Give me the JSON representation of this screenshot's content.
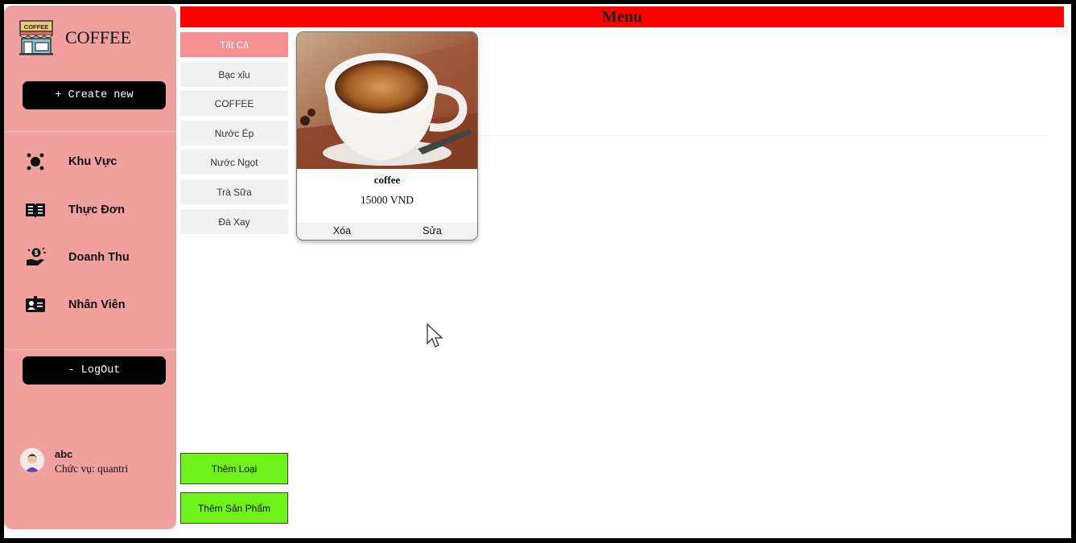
{
  "brand": {
    "title": "COFFEE",
    "logo_text": "COFFEE",
    "logo_icon": "coffee-shop-icon"
  },
  "sidebar": {
    "create_label": "+ Create new",
    "nav": [
      {
        "label": "Khu Vực",
        "icon": "area-icon"
      },
      {
        "label": "Thực Đơn",
        "icon": "menu-book-icon"
      },
      {
        "label": "Doanh Thu",
        "icon": "revenue-icon"
      },
      {
        "label": "Nhân Viên",
        "icon": "employee-icon"
      }
    ],
    "logout_label": "- LogOut"
  },
  "user": {
    "name": "abc",
    "role": "Chức vụ: quantri",
    "avatar_icon": "user-avatar-icon"
  },
  "header": {
    "title": "Menu"
  },
  "categories": [
    {
      "label": "Tất Cả",
      "active": true
    },
    {
      "label": "Bạc xỉu"
    },
    {
      "label": "COFFEE"
    },
    {
      "label": "Nước Ép"
    },
    {
      "label": "Nước Ngọt"
    },
    {
      "label": "Trà Sữa"
    },
    {
      "label": "Đá Xay"
    }
  ],
  "actions": {
    "add_category": "Thêm Loại",
    "add_product": "Thêm Sản Phẩm"
  },
  "products": [
    {
      "name": "coffee",
      "price": "15000 VND",
      "delete_label": "Xóa",
      "edit_label": "Sửa"
    }
  ],
  "colors": {
    "sidebar": "#f0a09f",
    "header": "#ff0000",
    "active_category": "#f58f91",
    "green_button": "#6ff11a",
    "black_button": "#000000"
  }
}
